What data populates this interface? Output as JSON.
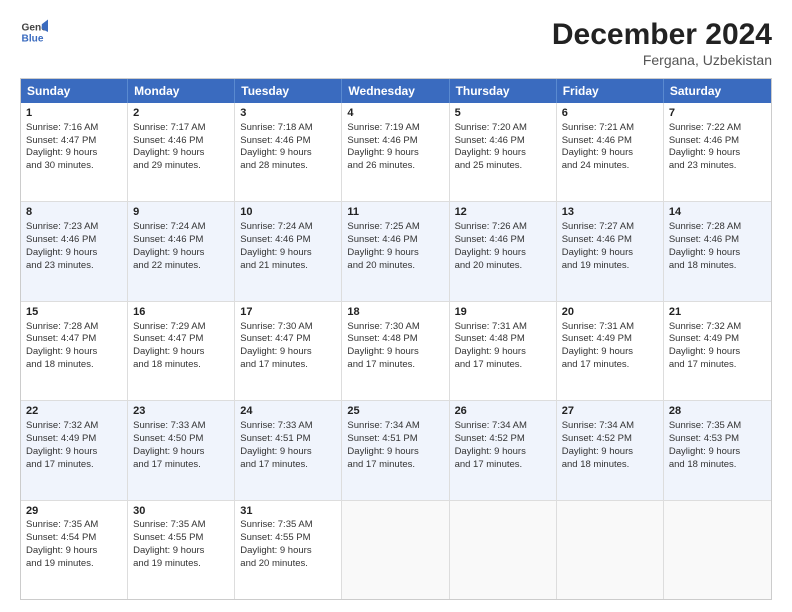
{
  "header": {
    "logo_line1": "General",
    "logo_line2": "Blue",
    "main_title": "December 2024",
    "subtitle": "Fergana, Uzbekistan"
  },
  "calendar": {
    "days_of_week": [
      "Sunday",
      "Monday",
      "Tuesday",
      "Wednesday",
      "Thursday",
      "Friday",
      "Saturday"
    ],
    "weeks": [
      [
        {
          "day": "1",
          "lines": [
            "Sunrise: 7:16 AM",
            "Sunset: 4:47 PM",
            "Daylight: 9 hours",
            "and 30 minutes."
          ]
        },
        {
          "day": "2",
          "lines": [
            "Sunrise: 7:17 AM",
            "Sunset: 4:46 PM",
            "Daylight: 9 hours",
            "and 29 minutes."
          ]
        },
        {
          "day": "3",
          "lines": [
            "Sunrise: 7:18 AM",
            "Sunset: 4:46 PM",
            "Daylight: 9 hours",
            "and 28 minutes."
          ]
        },
        {
          "day": "4",
          "lines": [
            "Sunrise: 7:19 AM",
            "Sunset: 4:46 PM",
            "Daylight: 9 hours",
            "and 26 minutes."
          ]
        },
        {
          "day": "5",
          "lines": [
            "Sunrise: 7:20 AM",
            "Sunset: 4:46 PM",
            "Daylight: 9 hours",
            "and 25 minutes."
          ]
        },
        {
          "day": "6",
          "lines": [
            "Sunrise: 7:21 AM",
            "Sunset: 4:46 PM",
            "Daylight: 9 hours",
            "and 24 minutes."
          ]
        },
        {
          "day": "7",
          "lines": [
            "Sunrise: 7:22 AM",
            "Sunset: 4:46 PM",
            "Daylight: 9 hours",
            "and 23 minutes."
          ]
        }
      ],
      [
        {
          "day": "8",
          "lines": [
            "Sunrise: 7:23 AM",
            "Sunset: 4:46 PM",
            "Daylight: 9 hours",
            "and 23 minutes."
          ]
        },
        {
          "day": "9",
          "lines": [
            "Sunrise: 7:24 AM",
            "Sunset: 4:46 PM",
            "Daylight: 9 hours",
            "and 22 minutes."
          ]
        },
        {
          "day": "10",
          "lines": [
            "Sunrise: 7:24 AM",
            "Sunset: 4:46 PM",
            "Daylight: 9 hours",
            "and 21 minutes."
          ]
        },
        {
          "day": "11",
          "lines": [
            "Sunrise: 7:25 AM",
            "Sunset: 4:46 PM",
            "Daylight: 9 hours",
            "and 20 minutes."
          ]
        },
        {
          "day": "12",
          "lines": [
            "Sunrise: 7:26 AM",
            "Sunset: 4:46 PM",
            "Daylight: 9 hours",
            "and 20 minutes."
          ]
        },
        {
          "day": "13",
          "lines": [
            "Sunrise: 7:27 AM",
            "Sunset: 4:46 PM",
            "Daylight: 9 hours",
            "and 19 minutes."
          ]
        },
        {
          "day": "14",
          "lines": [
            "Sunrise: 7:28 AM",
            "Sunset: 4:46 PM",
            "Daylight: 9 hours",
            "and 18 minutes."
          ]
        }
      ],
      [
        {
          "day": "15",
          "lines": [
            "Sunrise: 7:28 AM",
            "Sunset: 4:47 PM",
            "Daylight: 9 hours",
            "and 18 minutes."
          ]
        },
        {
          "day": "16",
          "lines": [
            "Sunrise: 7:29 AM",
            "Sunset: 4:47 PM",
            "Daylight: 9 hours",
            "and 18 minutes."
          ]
        },
        {
          "day": "17",
          "lines": [
            "Sunrise: 7:30 AM",
            "Sunset: 4:47 PM",
            "Daylight: 9 hours",
            "and 17 minutes."
          ]
        },
        {
          "day": "18",
          "lines": [
            "Sunrise: 7:30 AM",
            "Sunset: 4:48 PM",
            "Daylight: 9 hours",
            "and 17 minutes."
          ]
        },
        {
          "day": "19",
          "lines": [
            "Sunrise: 7:31 AM",
            "Sunset: 4:48 PM",
            "Daylight: 9 hours",
            "and 17 minutes."
          ]
        },
        {
          "day": "20",
          "lines": [
            "Sunrise: 7:31 AM",
            "Sunset: 4:49 PM",
            "Daylight: 9 hours",
            "and 17 minutes."
          ]
        },
        {
          "day": "21",
          "lines": [
            "Sunrise: 7:32 AM",
            "Sunset: 4:49 PM",
            "Daylight: 9 hours",
            "and 17 minutes."
          ]
        }
      ],
      [
        {
          "day": "22",
          "lines": [
            "Sunrise: 7:32 AM",
            "Sunset: 4:49 PM",
            "Daylight: 9 hours",
            "and 17 minutes."
          ]
        },
        {
          "day": "23",
          "lines": [
            "Sunrise: 7:33 AM",
            "Sunset: 4:50 PM",
            "Daylight: 9 hours",
            "and 17 minutes."
          ]
        },
        {
          "day": "24",
          "lines": [
            "Sunrise: 7:33 AM",
            "Sunset: 4:51 PM",
            "Daylight: 9 hours",
            "and 17 minutes."
          ]
        },
        {
          "day": "25",
          "lines": [
            "Sunrise: 7:34 AM",
            "Sunset: 4:51 PM",
            "Daylight: 9 hours",
            "and 17 minutes."
          ]
        },
        {
          "day": "26",
          "lines": [
            "Sunrise: 7:34 AM",
            "Sunset: 4:52 PM",
            "Daylight: 9 hours",
            "and 17 minutes."
          ]
        },
        {
          "day": "27",
          "lines": [
            "Sunrise: 7:34 AM",
            "Sunset: 4:52 PM",
            "Daylight: 9 hours",
            "and 18 minutes."
          ]
        },
        {
          "day": "28",
          "lines": [
            "Sunrise: 7:35 AM",
            "Sunset: 4:53 PM",
            "Daylight: 9 hours",
            "and 18 minutes."
          ]
        }
      ],
      [
        {
          "day": "29",
          "lines": [
            "Sunrise: 7:35 AM",
            "Sunset: 4:54 PM",
            "Daylight: 9 hours",
            "and 19 minutes."
          ]
        },
        {
          "day": "30",
          "lines": [
            "Sunrise: 7:35 AM",
            "Sunset: 4:55 PM",
            "Daylight: 9 hours",
            "and 19 minutes."
          ]
        },
        {
          "day": "31",
          "lines": [
            "Sunrise: 7:35 AM",
            "Sunset: 4:55 PM",
            "Daylight: 9 hours",
            "and 20 minutes."
          ]
        },
        {
          "day": "",
          "lines": []
        },
        {
          "day": "",
          "lines": []
        },
        {
          "day": "",
          "lines": []
        },
        {
          "day": "",
          "lines": []
        }
      ]
    ]
  }
}
